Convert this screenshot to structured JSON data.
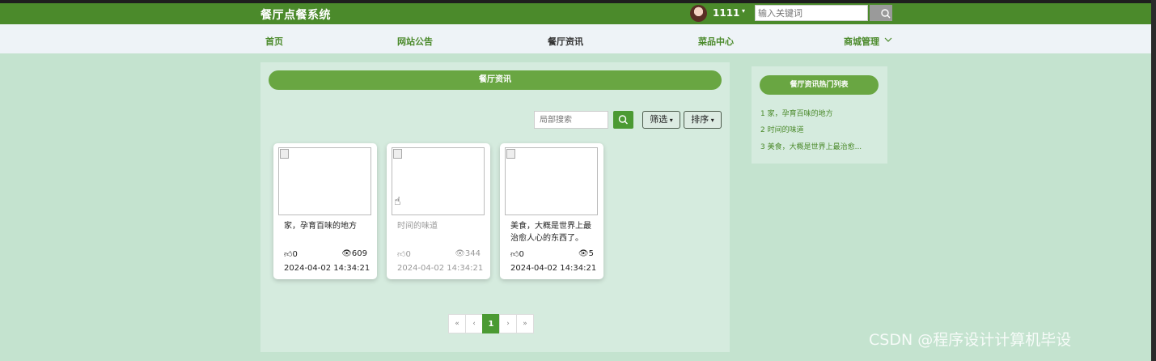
{
  "header": {
    "site_title": "餐厅点餐系统",
    "username": "1111",
    "search_placeholder": "输入关键词",
    "accent_color": "#4b8a2b"
  },
  "nav": {
    "items": [
      {
        "label": "首页",
        "active": false
      },
      {
        "label": "网站公告",
        "active": false
      },
      {
        "label": "餐厅资讯",
        "active": true
      },
      {
        "label": "菜品中心",
        "active": false
      },
      {
        "label": "商城管理",
        "active": false,
        "has_dropdown": true
      }
    ]
  },
  "main": {
    "section_title": "餐厅资讯",
    "local_search_placeholder": "局部搜索",
    "filter_label": "筛选",
    "sort_label": "排序",
    "cards": [
      {
        "title": "家，孕育百味的地方",
        "likes": "0",
        "views": "609",
        "date": "2024-04-02 14:34:21"
      },
      {
        "title": "时间的味道",
        "likes": "0",
        "views": "344",
        "date": "2024-04-02 14:34:21"
      },
      {
        "title": "美食，大概是世界上最治愈人心的东西了。",
        "likes": "0",
        "views": "5",
        "date": "2024-04-02 14:34:21"
      }
    ]
  },
  "sidebar": {
    "title": "餐厅资讯热门列表",
    "items": [
      "1  家，孕育百味的地方",
      "2  时间的味道",
      "3  美食，大概是世界上最治愈..."
    ]
  },
  "pagination": {
    "first": "«",
    "prev": "‹",
    "current": "1",
    "next": "›",
    "last": "»"
  },
  "watermark": "CSDN @程序设计计算机毕设"
}
